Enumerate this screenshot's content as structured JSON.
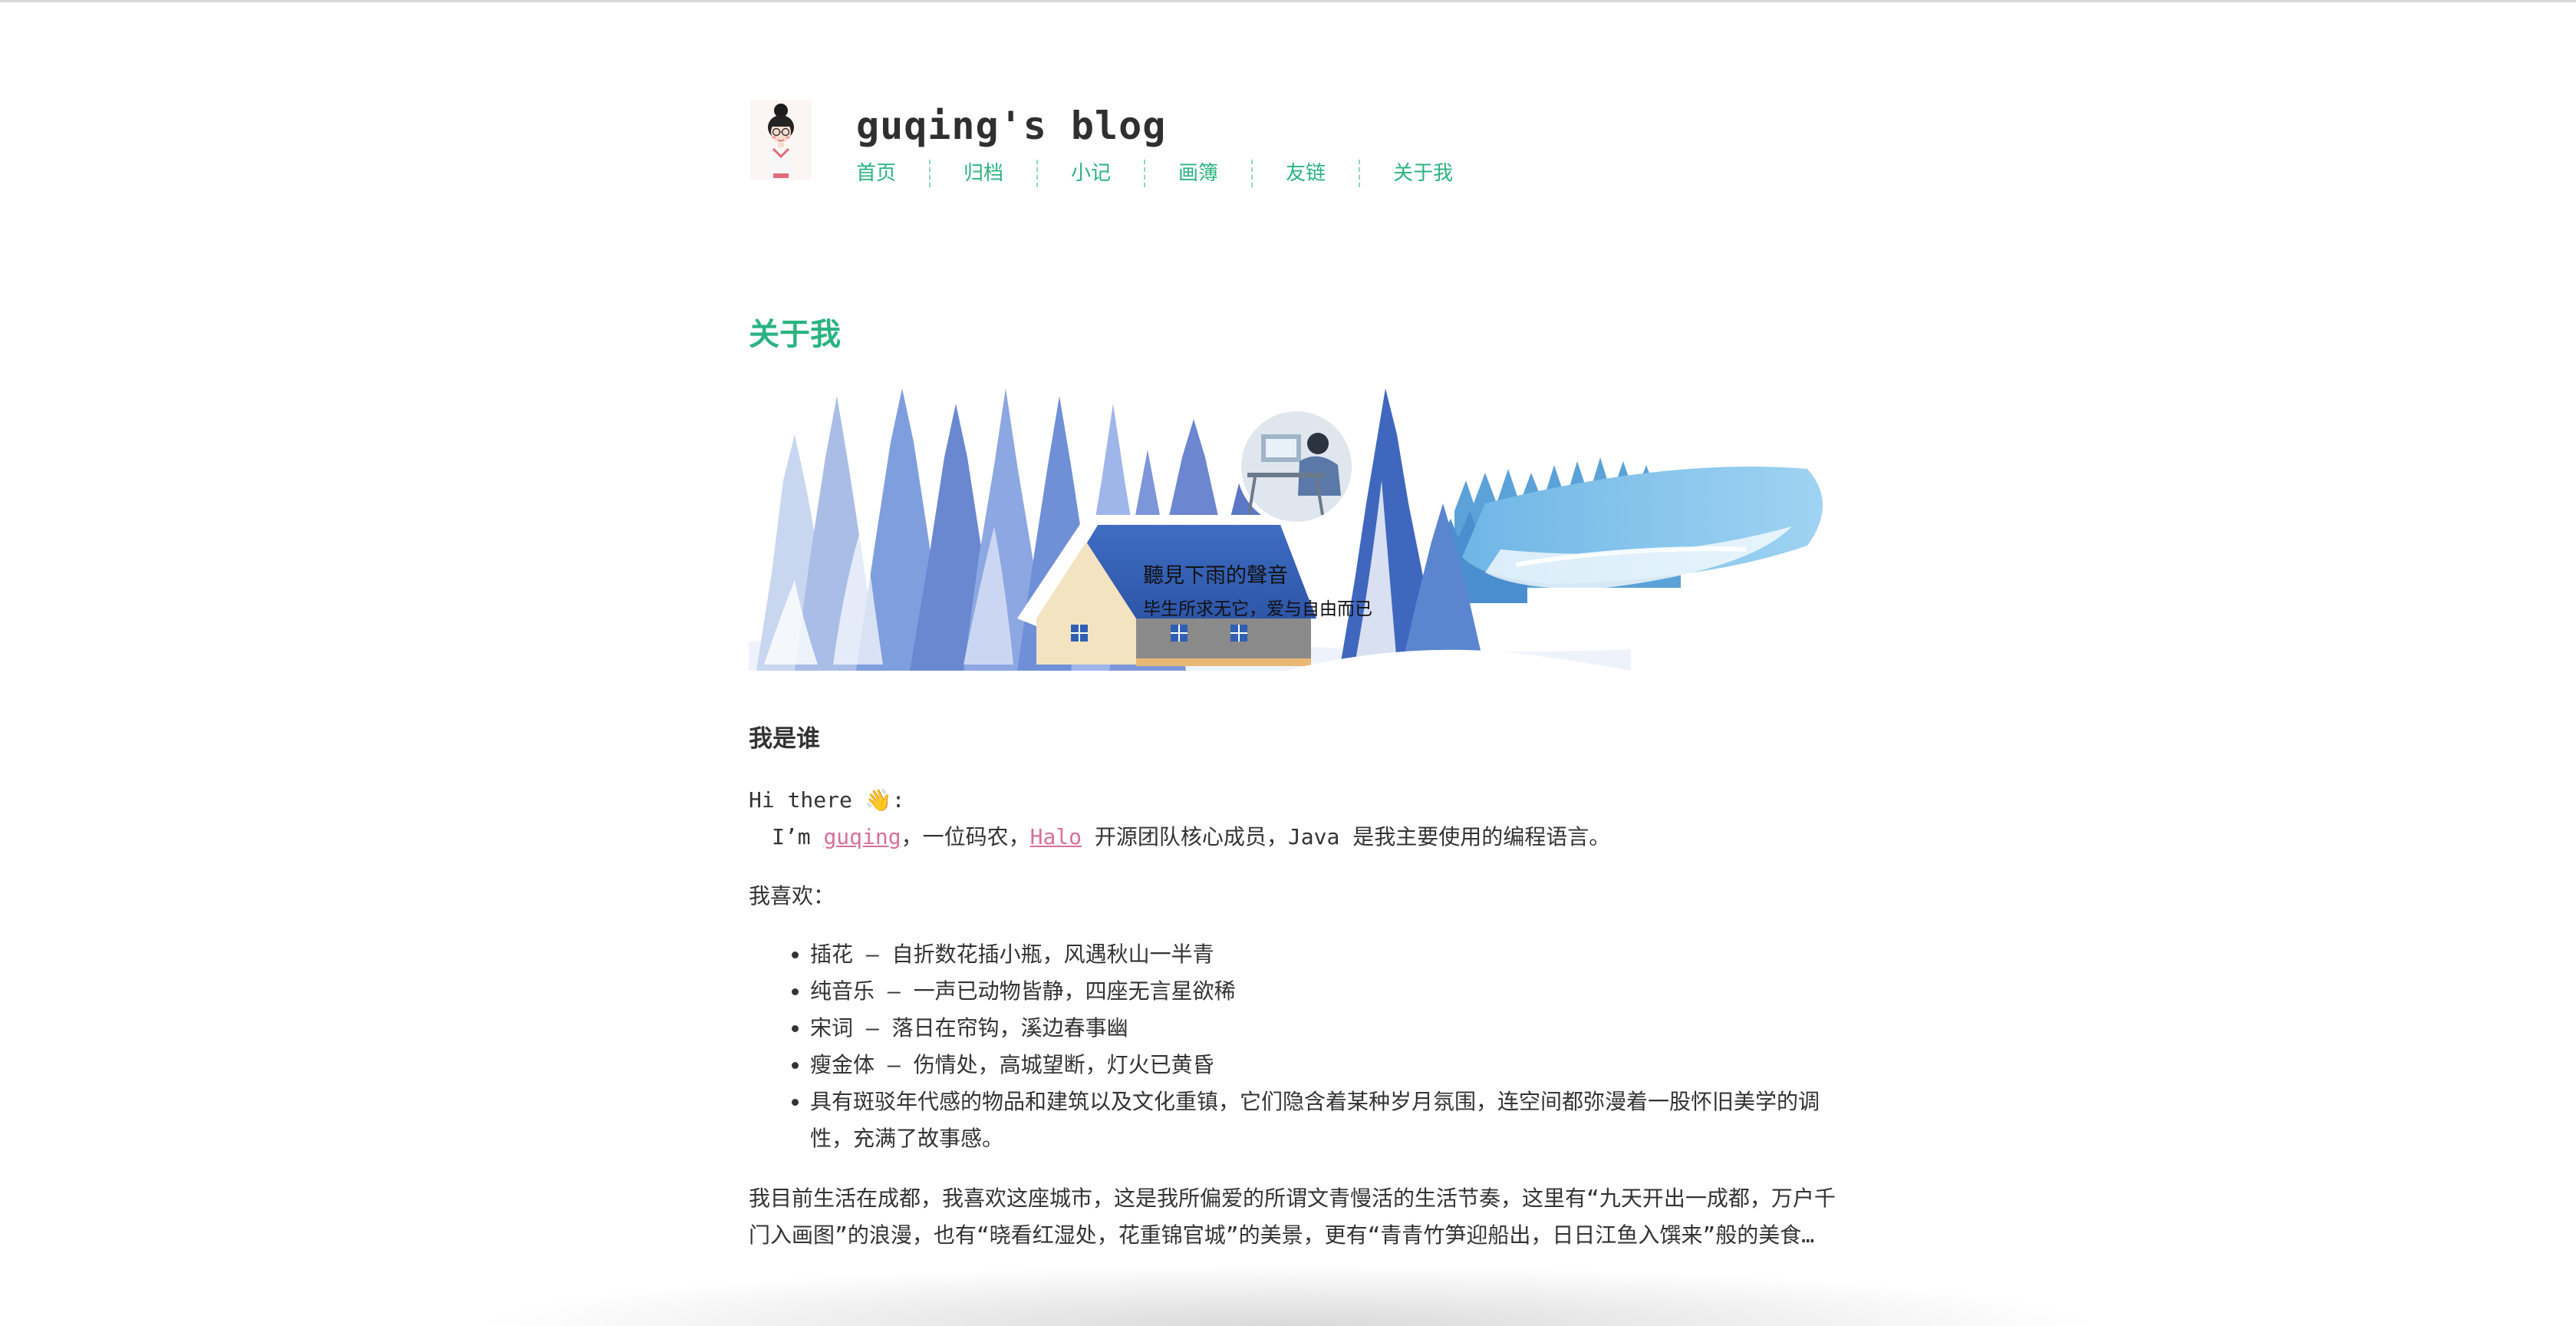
{
  "site": {
    "title": "guqing's blog",
    "nav": [
      "首页",
      "归档",
      "小记",
      "画簿",
      "友链",
      "关于我"
    ]
  },
  "page": {
    "heading": "关于我",
    "banner": {
      "line1": "聽見下雨的聲音",
      "line2": "毕生所求无它，爱与自由而已"
    },
    "section_title": "我是谁",
    "greeting": "Hi there 👋:",
    "intro": {
      "prefix": "I’m ",
      "name_link": "guqing",
      "middle": "，一位码农，",
      "halo_link": "Halo",
      "suffix": " 开源团队核心成员，Java 是我主要使用的编程语言。"
    },
    "likes_label": "我喜欢：",
    "likes": [
      "插花 – 自折数花插小瓶，风遇秋山一半青",
      "纯音乐 – 一声已动物皆静，四座无言星欲稀",
      "宋词 – 落日在帘钩，溪边春事幽",
      "瘦金体 – 伤情处，高城望断，灯火已黄昏",
      "具有斑驳年代感的物品和建筑以及文化重镇，它们隐含着某种岁月氛围，连空间都弥漫着一股怀旧美学的调性，充满了故事感。"
    ],
    "paragraph": "我目前生活在成都，我喜欢这座城市，这是我所偏爱的所谓文青慢活的生活节奏，这里有“九天开出一成都，万户千门入画图”的浪漫，也有“晓看红湿处，花重锦官城”的美景，更有“青青竹笋迎船出，日日江鱼入馔来”般的美食…"
  },
  "colors": {
    "accent": "#2bb382",
    "link": "#d6709a",
    "text": "#333333"
  }
}
